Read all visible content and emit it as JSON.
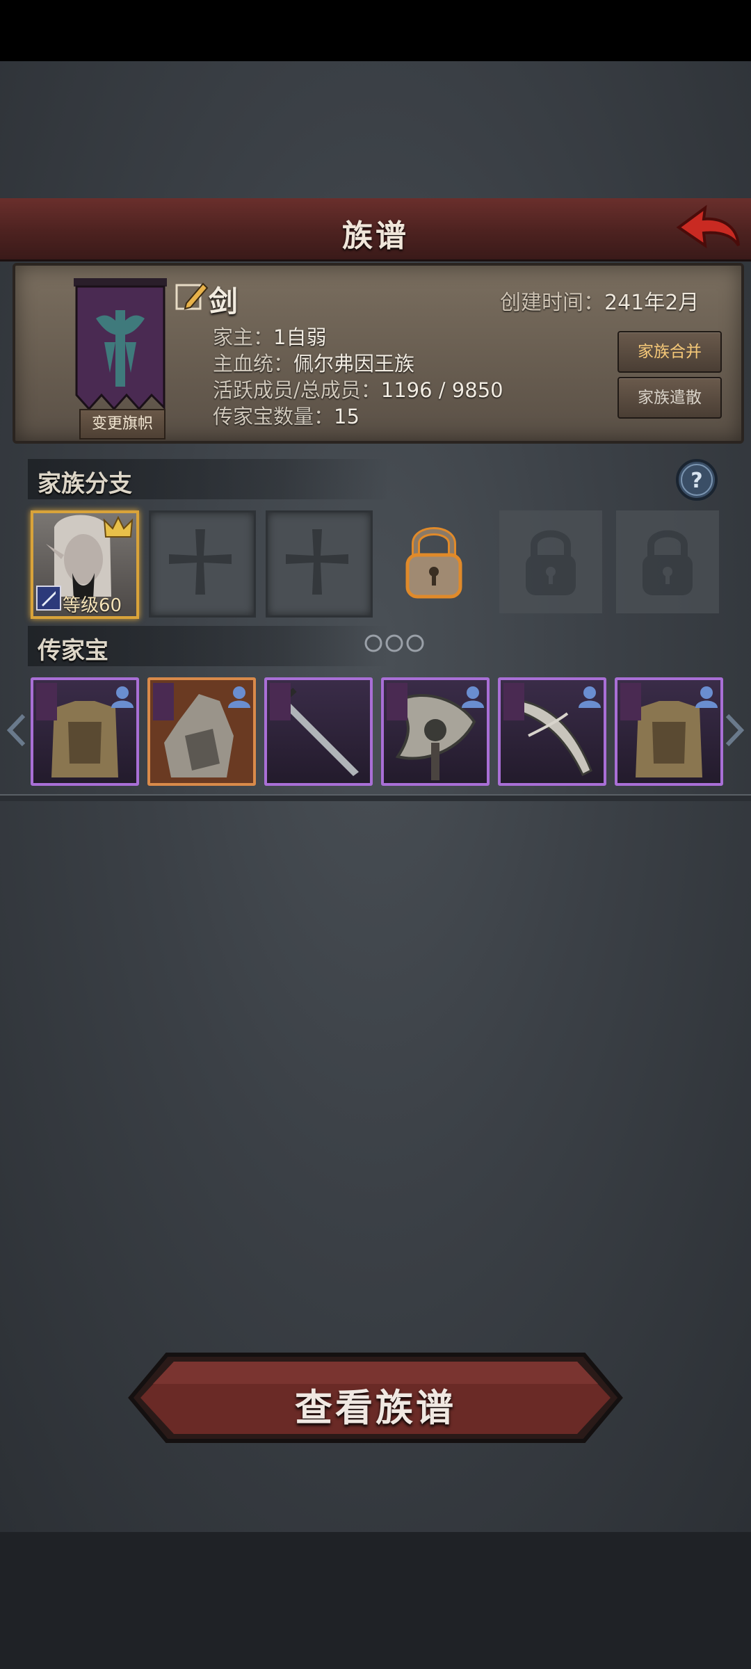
{
  "header": {
    "title": "族谱"
  },
  "family": {
    "change_flag_label": "变更旗帜",
    "name": "剑",
    "created_label": "创建时间：",
    "created_value": "241年2月",
    "leader_label": "家主：",
    "leader_value": "1自弱",
    "bloodline_label": "主血统：",
    "bloodline_value": "佩尔弗因王族",
    "members_label": "活跃成员/总成员：",
    "members_value": "1196 / 9850",
    "heirloom_count_label": "传家宝数量：",
    "heirloom_count_value": "15",
    "merge_label": "家族合并",
    "disband_label": "家族遣散"
  },
  "branches": {
    "title": "家族分支",
    "leader_level": "等级60",
    "slots": [
      "portrait",
      "empty",
      "empty",
      "locked-active",
      "locked",
      "locked"
    ]
  },
  "heirlooms": {
    "title": "传家宝",
    "items": [
      {
        "type": "armor-icon",
        "rarity": "purple"
      },
      {
        "type": "golem-icon",
        "rarity": "orange"
      },
      {
        "type": "sword-icon",
        "rarity": "purple"
      },
      {
        "type": "axe-icon",
        "rarity": "purple"
      },
      {
        "type": "scimitar-icon",
        "rarity": "purple"
      },
      {
        "type": "armor-icon",
        "rarity": "purple"
      }
    ]
  },
  "footer": {
    "view_label": "查看族谱"
  },
  "colors": {
    "purple": "#a96fd6",
    "orange": "#d98a4a",
    "gold": "#d9a33a",
    "banner": "#4a2a52"
  }
}
